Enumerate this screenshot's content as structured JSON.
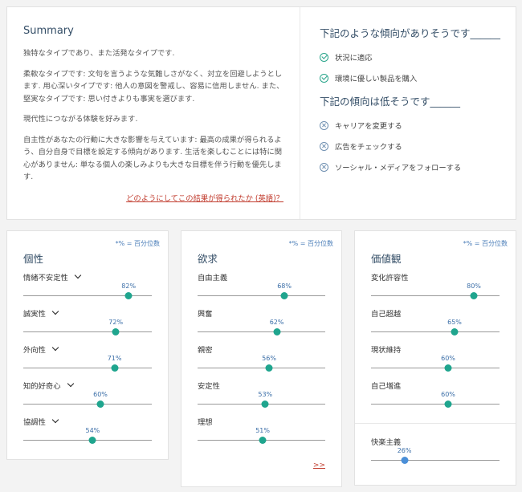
{
  "summary": {
    "title": "Summary",
    "paragraphs": [
      "独特なタイプであり、また活発なタイプです.",
      "柔軟なタイプです: 文句を言うような気難しさがなく、対立を回避しようとします. 用心深いタイプです: 他人の意図を警戒し、容易に信用しません. また、堅実なタイプです: 思い付きよりも事実を選びます.",
      "現代性につながる体験を好みます.",
      "自主性があなたの行動に大きな影響を与えています: 最高の成果が得られるよう、自分自身で目標を設定する傾向があります. 生活を楽しむことには特に関心がありません: 単なる個人の楽しみよりも大きな目標を伴う行動を優先します."
    ],
    "link": "どのようにしてこの結果が得られたか (英語)？"
  },
  "trends": {
    "likely_heading": "下記のような傾向がありそうです______",
    "likely": [
      "状況に適応",
      "環境に優しい製品を購入"
    ],
    "unlikely_heading": "下記の傾向は低そうです______",
    "unlikely": [
      "キャリアを変更する",
      "広告をチェックする",
      "ソーシャル・メディアをフォローする"
    ]
  },
  "panels": {
    "pct_note": "*% = 百分位数",
    "personality": {
      "title": "個性",
      "traits": [
        {
          "label": "情緒不安定性",
          "value": 82,
          "pct": "82%"
        },
        {
          "label": "誠実性",
          "value": 72,
          "pct": "72%"
        },
        {
          "label": "外向性",
          "value": 71,
          "pct": "71%"
        },
        {
          "label": "知的好奇心",
          "value": 60,
          "pct": "60%"
        },
        {
          "label": "協調性",
          "value": 54,
          "pct": "54%"
        }
      ]
    },
    "needs": {
      "title": "欲求",
      "traits": [
        {
          "label": "自由主義",
          "value": 68,
          "pct": "68%"
        },
        {
          "label": "興奮",
          "value": 62,
          "pct": "62%"
        },
        {
          "label": "親密",
          "value": 56,
          "pct": "56%"
        },
        {
          "label": "安定性",
          "value": 53,
          "pct": "53%"
        },
        {
          "label": "理想",
          "value": 51,
          "pct": "51%"
        }
      ],
      "more": ">>"
    },
    "values": {
      "title": "価値観",
      "traits": [
        {
          "label": "変化許容性",
          "value": 80,
          "pct": "80%"
        },
        {
          "label": "自己超越",
          "value": 65,
          "pct": "65%"
        },
        {
          "label": "現状維持",
          "value": 60,
          "pct": "60%"
        },
        {
          "label": "自己増進",
          "value": 60,
          "pct": "60%"
        },
        {
          "label": "快楽主義",
          "value": 26,
          "pct": "26%"
        }
      ]
    }
  },
  "colors": {
    "accent": "#1fa58e",
    "secondary_dot": "#4a8fd8",
    "link": "#c0392b"
  }
}
